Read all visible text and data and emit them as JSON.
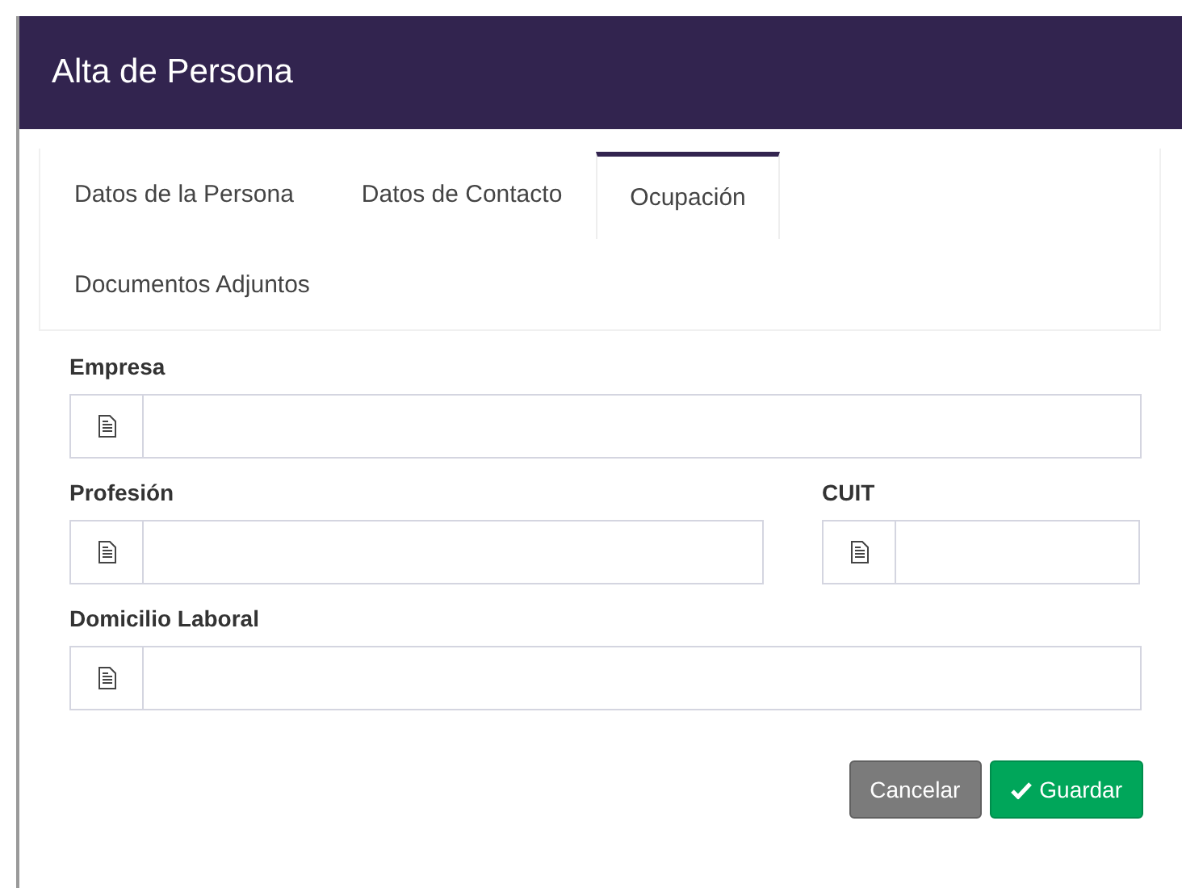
{
  "dialog": {
    "title": "Alta de Persona"
  },
  "tabs": [
    {
      "label": "Datos de la Persona",
      "selected": false
    },
    {
      "label": "Datos de Contacto",
      "selected": false
    },
    {
      "label": "Ocupación",
      "selected": true
    },
    {
      "label": "Documentos Adjuntos",
      "selected": false
    }
  ],
  "form_rows": [
    [
      {
        "label": "Empresa"
      }
    ],
    [
      {
        "label": "Profesión"
      },
      {
        "label": "CUIT"
      }
    ],
    [
      {
        "label": "Domicilio Laboral"
      }
    ]
  ],
  "buttons": [
    {
      "label": "Cancelar",
      "kind": "secondary"
    },
    {
      "label": "Guardar",
      "kind": "primary"
    }
  ]
}
